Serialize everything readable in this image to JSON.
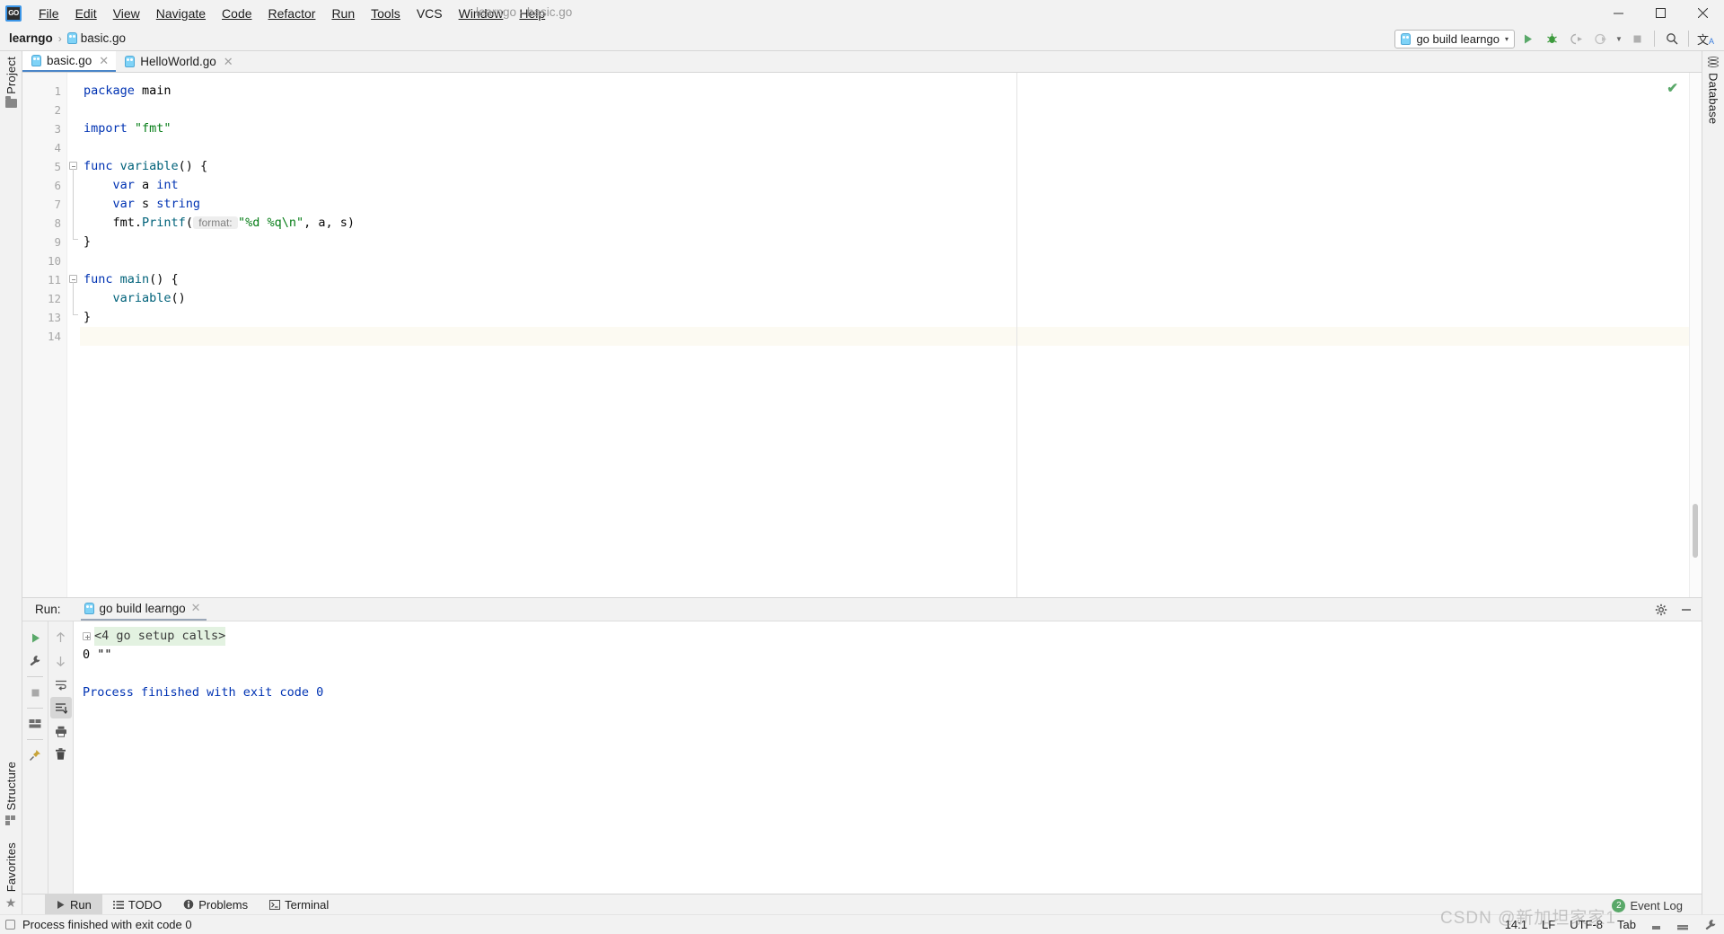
{
  "window": {
    "title": "learngo - basic.go",
    "logo_text": "GO",
    "controls": {
      "minimize": "—",
      "maximize": "☐",
      "close": "✕"
    }
  },
  "menu": {
    "items": [
      {
        "label": "File"
      },
      {
        "label": "Edit"
      },
      {
        "label": "View"
      },
      {
        "label": "Navigate"
      },
      {
        "label": "Code"
      },
      {
        "label": "Refactor"
      },
      {
        "label": "Run"
      },
      {
        "label": "Tools"
      },
      {
        "label": "VCS"
      },
      {
        "label": "Window"
      },
      {
        "label": "Help"
      }
    ]
  },
  "breadcrumb": {
    "project": "learngo",
    "separator": "›",
    "file": "basic.go"
  },
  "toolbar": {
    "run_config": "go build learngo",
    "caret": "▾",
    "buttons": [
      {
        "name": "run-button",
        "glyph": "▶"
      },
      {
        "name": "debug-button",
        "glyph": "🐞"
      },
      {
        "name": "run-with-coverage-button",
        "glyph": "▷"
      },
      {
        "name": "profile-button",
        "glyph": "◴"
      },
      {
        "name": "stop-button",
        "glyph": "■"
      },
      {
        "name": "search-everywhere-button",
        "glyph": "🔍"
      },
      {
        "name": "translate-button",
        "glyph": "文A"
      }
    ]
  },
  "left_strip": {
    "top": [
      {
        "label": "Project",
        "icon": "folder-icon"
      }
    ],
    "bottom": [
      {
        "label": "Structure",
        "icon": "structure-icon"
      },
      {
        "label": "Favorites",
        "icon": "star-icon"
      }
    ]
  },
  "right_strip": {
    "items": [
      {
        "label": "Database",
        "icon": "database-icon"
      }
    ]
  },
  "editor": {
    "tabs": [
      {
        "label": "basic.go",
        "active": true
      },
      {
        "label": "HelloWorld.go",
        "active": false
      }
    ],
    "close_glyph": "✕",
    "inspection_ok": "✔",
    "lines": [
      {
        "n": "1",
        "tokens": [
          {
            "t": "package ",
            "c": "kw"
          },
          {
            "t": "main",
            "c": "pkg"
          }
        ]
      },
      {
        "n": "2",
        "tokens": []
      },
      {
        "n": "3",
        "tokens": [
          {
            "t": "import ",
            "c": "kw"
          },
          {
            "t": "\"fmt\"",
            "c": "str"
          }
        ]
      },
      {
        "n": "4",
        "tokens": []
      },
      {
        "n": "5",
        "fold": "start",
        "tokens": [
          {
            "t": "func ",
            "c": "kw"
          },
          {
            "t": "variable",
            "c": "fn"
          },
          {
            "t": "() {",
            "c": "plain"
          }
        ]
      },
      {
        "n": "6",
        "fold": "bar",
        "tokens": [
          {
            "t": "    ",
            "c": "plain"
          },
          {
            "t": "var ",
            "c": "kw"
          },
          {
            "t": "a ",
            "c": "plain"
          },
          {
            "t": "int",
            "c": "typ"
          }
        ]
      },
      {
        "n": "7",
        "fold": "bar",
        "tokens": [
          {
            "t": "    ",
            "c": "plain"
          },
          {
            "t": "var ",
            "c": "kw"
          },
          {
            "t": "s ",
            "c": "plain"
          },
          {
            "t": "string",
            "c": "typ"
          }
        ]
      },
      {
        "n": "8",
        "fold": "bar",
        "tokens": [
          {
            "t": "    ",
            "c": "plain"
          },
          {
            "t": "fmt",
            "c": "plain"
          },
          {
            "t": ".",
            "c": "plain"
          },
          {
            "t": "Printf",
            "c": "fn"
          },
          {
            "t": "(",
            "c": "plain"
          },
          {
            "t": " format: ",
            "c": "hint"
          },
          {
            "t": "\"%d %q\\n\"",
            "c": "str"
          },
          {
            "t": ", a, s)",
            "c": "plain"
          }
        ]
      },
      {
        "n": "9",
        "fold": "end",
        "tokens": [
          {
            "t": "}",
            "c": "plain"
          }
        ]
      },
      {
        "n": "10",
        "tokens": []
      },
      {
        "n": "11",
        "runmark": true,
        "fold": "start",
        "tokens": [
          {
            "t": "func ",
            "c": "kw"
          },
          {
            "t": "main",
            "c": "fn"
          },
          {
            "t": "() {",
            "c": "plain"
          }
        ]
      },
      {
        "n": "12",
        "fold": "bar",
        "tokens": [
          {
            "t": "    ",
            "c": "plain"
          },
          {
            "t": "variable",
            "c": "fn"
          },
          {
            "t": "()",
            "c": "plain"
          }
        ]
      },
      {
        "n": "13",
        "fold": "end",
        "tokens": [
          {
            "t": "}",
            "c": "plain"
          }
        ]
      },
      {
        "n": "14",
        "caret": true,
        "tokens": []
      }
    ]
  },
  "run_panel": {
    "label": "Run:",
    "tab": "go build learngo",
    "close_glyph": "✕",
    "settings_glyph": "⚙",
    "hide_glyph": "—",
    "tools_col_a": [
      {
        "name": "rerun-button",
        "glyph": "▶"
      },
      {
        "name": "edit-configuration-button",
        "glyph": "🔧"
      },
      {
        "name": "stop-button",
        "glyph": "■"
      },
      {
        "name": "layout-button",
        "glyph": "▤"
      },
      {
        "name": "pin-tab-button",
        "glyph": "📌"
      }
    ],
    "tools_col_b": [
      {
        "name": "up-stack-trace-button",
        "glyph": "↑"
      },
      {
        "name": "down-stack-trace-button",
        "glyph": "↓"
      },
      {
        "name": "soft-wrap-button",
        "glyph": "↵"
      },
      {
        "name": "scroll-to-end-button",
        "glyph": "↧",
        "selected": true
      },
      {
        "name": "print-button",
        "glyph": "🖨"
      },
      {
        "name": "clear-all-button",
        "glyph": "🗑"
      }
    ],
    "console": [
      {
        "text": "<4 go setup calls>",
        "style": "setup",
        "expander": true
      },
      {
        "text": "0 \"\"",
        "style": "out"
      },
      {
        "text": "",
        "style": "out"
      },
      {
        "text": "Process finished with exit code 0",
        "style": "fin"
      }
    ]
  },
  "bottom_bar": {
    "items": [
      {
        "label": "Run",
        "icon": "play-icon",
        "active": true
      },
      {
        "label": "TODO",
        "icon": "list-icon",
        "active": false
      },
      {
        "label": "Problems",
        "icon": "info-icon",
        "active": false
      },
      {
        "label": "Terminal",
        "icon": "terminal-icon",
        "active": false
      }
    ]
  },
  "status_bar": {
    "message": "Process finished with exit code 0",
    "caret_position": "14:1",
    "line_separator": "LF",
    "encoding": "UTF-8",
    "indent": "Tab",
    "event_log": "Event Log",
    "event_badge": "2",
    "watermark": "CSDN @新加坦家家1"
  },
  "colors": {
    "accent_blue": "#4b86c8",
    "keyword": "#0033b3",
    "string": "#067d17",
    "function": "#00627a",
    "run_green": "#59a869",
    "console_setup_bg": "#e3f2e1",
    "chrome_bg": "#f2f2f2"
  }
}
